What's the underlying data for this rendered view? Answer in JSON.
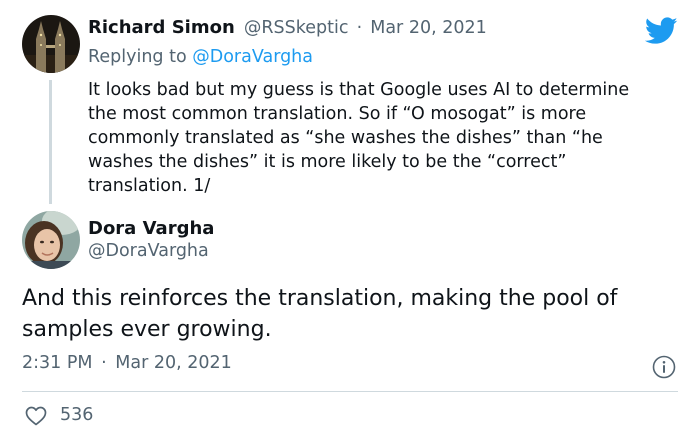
{
  "reply_tweet": {
    "author_name": "Richard Simon",
    "author_handle": "@RSSkeptic",
    "separator": "·",
    "date": "Mar 20, 2021",
    "replying_prefix": "Replying to",
    "replying_handle": "@DoraVargha",
    "text_lines": [
      "It looks bad but my guess is that Google uses AI to determine",
      "the most common translation. So if “O mosogat” is more",
      "commonly translated as “she washes the dishes” than “he",
      "washes the dishes” it is more likely to be the “correct”",
      "translation. 1/"
    ]
  },
  "main_tweet": {
    "author_name": "Dora Vargha",
    "author_handle": "@DoraVargha",
    "text_lines": [
      "And this reinforces the translation, making the pool of",
      "samples ever growing."
    ],
    "time": "2:31 PM",
    "separator": "·",
    "date": "Mar 20, 2021",
    "like_count": "536"
  },
  "icons": {
    "logo": "twitter-bird-icon",
    "info": "info-icon",
    "like": "heart-icon"
  },
  "colors": {
    "brand": "#1d9bf0",
    "muted": "#536471",
    "text": "#0f1419",
    "divider": "#cfd9de"
  }
}
